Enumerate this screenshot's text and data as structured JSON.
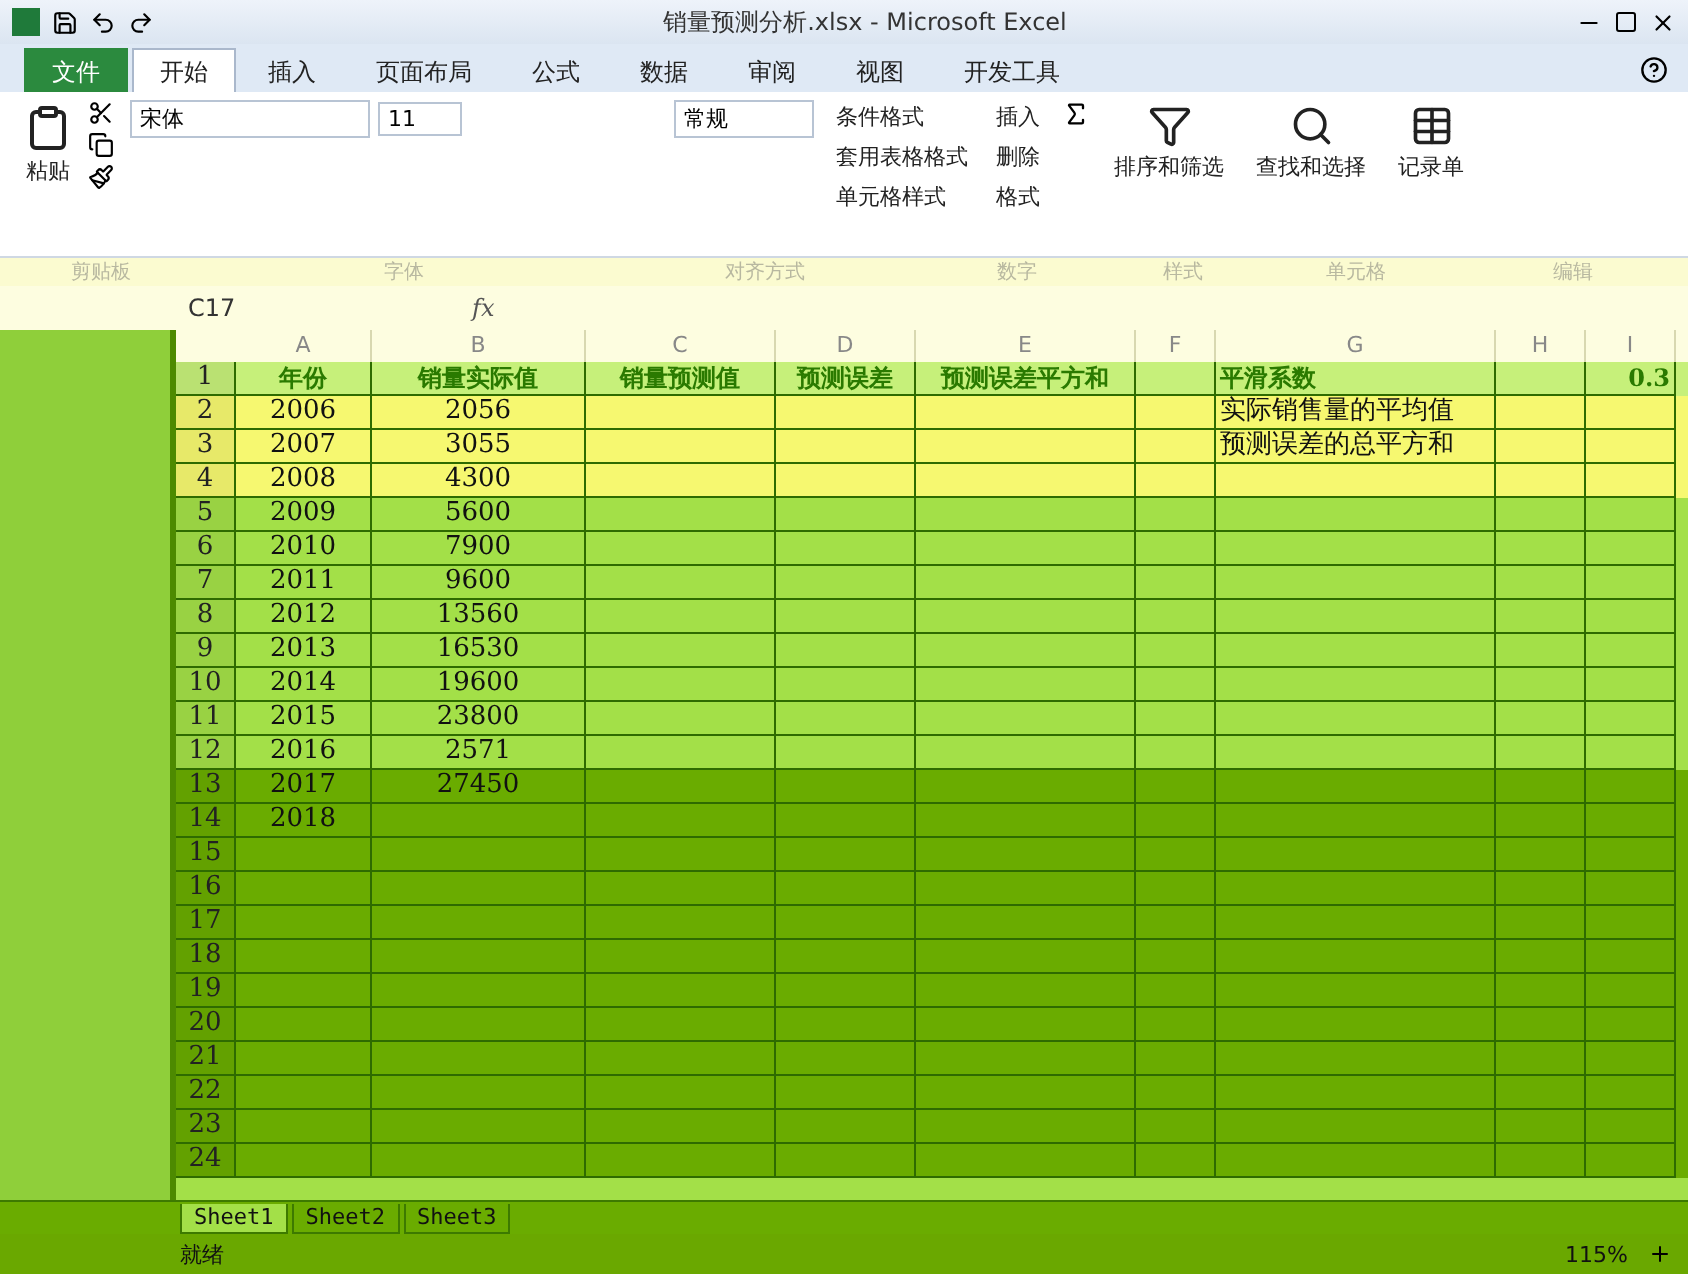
{
  "window": {
    "title": "销量预测分析.xlsx - Microsoft Excel"
  },
  "ribbon_tabs": [
    {
      "label": "文件",
      "kind": "file",
      "selected": false
    },
    {
      "label": "开始",
      "kind": "tab",
      "selected": true
    },
    {
      "label": "插入",
      "kind": "tab",
      "selected": false
    },
    {
      "label": "页面布局",
      "kind": "tab",
      "selected": false
    },
    {
      "label": "公式",
      "kind": "tab",
      "selected": false
    },
    {
      "label": "数据",
      "kind": "tab",
      "selected": false
    },
    {
      "label": "审阅",
      "kind": "tab",
      "selected": false
    },
    {
      "label": "视图",
      "kind": "tab",
      "selected": false
    },
    {
      "label": "开发工具",
      "kind": "tab",
      "selected": false
    }
  ],
  "ribbon": {
    "paste": "粘贴",
    "font_name": "宋体",
    "font_size": "11",
    "number_format": "常规",
    "conditional_format": "条件格式",
    "table_format": "套用表格格式",
    "cell_styles": "单元格样式",
    "insert": "插入",
    "delete": "删除",
    "format": "格式",
    "sort_filter": "排序和筛选",
    "find_select": "查找和选择",
    "record": "记录单"
  },
  "ribbon_groups": [
    "剪贴板",
    "字体",
    "对齐方式",
    "数字",
    "样式",
    "单元格",
    "编辑"
  ],
  "formula_bar": {
    "name_box": "C17",
    "fx": "fx"
  },
  "columns": [
    "A",
    "B",
    "C",
    "D",
    "E",
    "F",
    "G",
    "H",
    "I"
  ],
  "rows": [
    {
      "num": "1",
      "header": true,
      "cells": {
        "A": "年份",
        "B": "销量实际值",
        "C": "销量预测值",
        "D": "预测误差",
        "E": "预测误差平方和",
        "G": "平滑系数",
        "I": "0.3"
      }
    },
    {
      "num": "2",
      "header": false,
      "cells": {
        "A": "2006",
        "B": "2056",
        "G": "实际销售量的平均值"
      }
    },
    {
      "num": "3",
      "header": false,
      "cells": {
        "A": "2007",
        "B": "3055",
        "G": "预测误差的总平方和"
      }
    },
    {
      "num": "4",
      "header": false,
      "cells": {
        "A": "2008",
        "B": "4300"
      }
    },
    {
      "num": "5",
      "header": false,
      "cells": {
        "A": "2009",
        "B": "5600"
      }
    },
    {
      "num": "6",
      "header": false,
      "cells": {
        "A": "2010",
        "B": "7900"
      }
    },
    {
      "num": "7",
      "header": false,
      "cells": {
        "A": "2011",
        "B": "9600"
      }
    },
    {
      "num": "8",
      "header": false,
      "cells": {
        "A": "2012",
        "B": "13560"
      }
    },
    {
      "num": "9",
      "header": false,
      "cells": {
        "A": "2013",
        "B": "16530"
      }
    },
    {
      "num": "10",
      "header": false,
      "cells": {
        "A": "2014",
        "B": "19600"
      }
    },
    {
      "num": "11",
      "header": false,
      "cells": {
        "A": "2015",
        "B": "23800"
      }
    },
    {
      "num": "12",
      "header": false,
      "cells": {
        "A": "2016",
        "B": "2571"
      }
    },
    {
      "num": "13",
      "header": false,
      "cells": {
        "A": "2017",
        "B": "27450"
      }
    },
    {
      "num": "14",
      "header": false,
      "cells": {
        "A": "2018"
      }
    },
    {
      "num": "15",
      "header": false,
      "cells": {}
    },
    {
      "num": "16",
      "header": false,
      "cells": {}
    },
    {
      "num": "17",
      "header": false,
      "cells": {}
    },
    {
      "num": "18",
      "header": false,
      "cells": {}
    },
    {
      "num": "19",
      "header": false,
      "cells": {}
    },
    {
      "num": "20",
      "header": false,
      "cells": {}
    },
    {
      "num": "21",
      "header": false,
      "cells": {}
    },
    {
      "num": "22",
      "header": false,
      "cells": {}
    },
    {
      "num": "23",
      "header": false,
      "cells": {}
    },
    {
      "num": "24",
      "header": false,
      "cells": {}
    }
  ],
  "sheet_tabs": [
    {
      "label": "Sheet1",
      "selected": true
    },
    {
      "label": "Sheet2",
      "selected": false
    },
    {
      "label": "Sheet3",
      "selected": false
    }
  ],
  "status_bar": {
    "status": "就绪",
    "zoom": "115%"
  }
}
